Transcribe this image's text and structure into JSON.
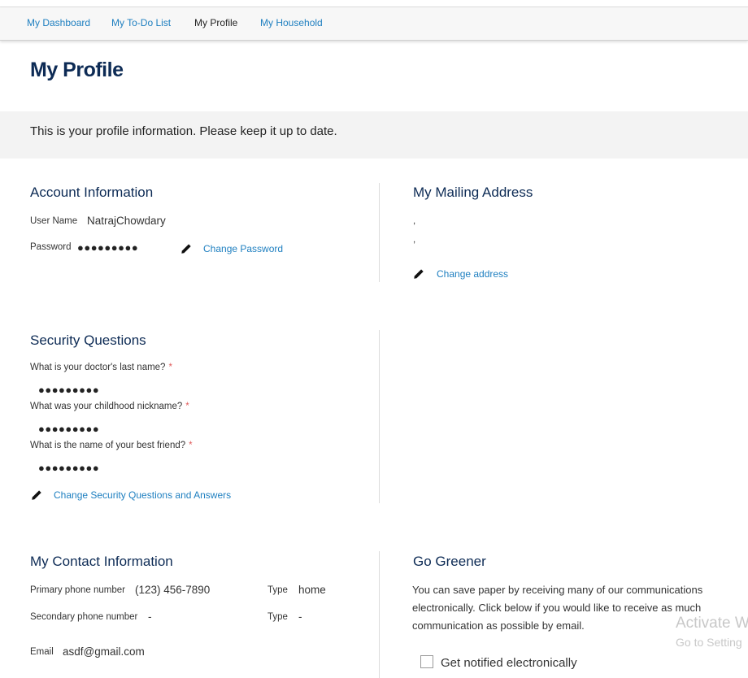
{
  "nav": {
    "items": [
      {
        "label": "My Dashboard"
      },
      {
        "label": "My To-Do List"
      },
      {
        "label": "My Profile"
      },
      {
        "label": "My Household"
      }
    ]
  },
  "page": {
    "title": "My Profile",
    "intro": "This is your profile information. Please keep it up to date."
  },
  "account": {
    "heading": "Account Information",
    "username_label": "User Name",
    "username_value": "NatrajChowdary",
    "password_label": "Password",
    "password_value": "●●●●●●●●●",
    "change_password": "Change Password"
  },
  "mailing": {
    "heading": "My Mailing Address",
    "line1": ",",
    "line2": ",",
    "change_address": "Change address"
  },
  "security": {
    "heading": "Security Questions",
    "questions": [
      {
        "q": "What is your doctor's last name?",
        "required": "*",
        "answer": "●●●●●●●●●"
      },
      {
        "q": "What was your childhood nickname?",
        "required": "*",
        "answer": "●●●●●●●●●"
      },
      {
        "q": "What is the name of your best friend?",
        "required": "*",
        "answer": "●●●●●●●●●"
      }
    ],
    "change_link": "Change Security Questions and Answers"
  },
  "contact": {
    "heading": "My Contact Information",
    "primary_label": "Primary phone number",
    "primary_value": "(123) 456-7890",
    "primary_type_label": "Type",
    "primary_type_value": "home",
    "secondary_label": "Secondary phone number",
    "secondary_value": "-",
    "secondary_type_label": "Type",
    "secondary_type_value": "-",
    "email_label": "Email",
    "email_value": "asdf@gmail.com"
  },
  "greener": {
    "heading": "Go Greener",
    "description": "You can save paper by receiving many of our communications electronically. Click below if you would like to receive as much communication as possible by email.",
    "checkbox_label": "Get notified electronically"
  },
  "watermark": {
    "line1": "Activate W",
    "line2": "Go to Setting"
  },
  "colors": {
    "heading": "#0d2b55",
    "link": "#1e7fc0",
    "band": "#f3f3f3",
    "required": "#e05a5a"
  },
  "icons": [
    "pencil-icon"
  ]
}
